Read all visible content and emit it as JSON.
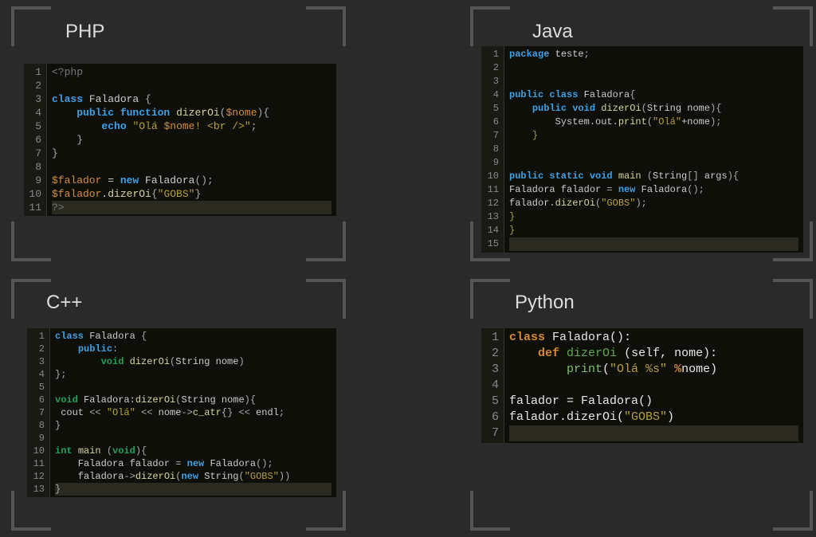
{
  "panels": {
    "php": {
      "title": "PHP",
      "lines": [
        {
          "n": "1",
          "segs": [
            {
              "c": "tag",
              "t": "<?php"
            }
          ]
        },
        {
          "n": "2",
          "segs": []
        },
        {
          "n": "3",
          "segs": [
            {
              "c": "kw",
              "t": "class"
            },
            {
              "c": "op",
              "t": " Faladora "
            },
            {
              "c": "pun",
              "t": "{"
            }
          ]
        },
        {
          "n": "4",
          "segs": [
            {
              "c": "op",
              "t": "    "
            },
            {
              "c": "kw",
              "t": "public function"
            },
            {
              "c": "op",
              "t": " "
            },
            {
              "c": "fn",
              "t": "dizerOi"
            },
            {
              "c": "pun",
              "t": "("
            },
            {
              "c": "var",
              "t": "$nome"
            },
            {
              "c": "pun",
              "t": "){"
            }
          ]
        },
        {
          "n": "5",
          "segs": [
            {
              "c": "op",
              "t": "        "
            },
            {
              "c": "kw",
              "t": "echo"
            },
            {
              "c": "op",
              "t": " "
            },
            {
              "c": "str",
              "t": "\"Olá "
            },
            {
              "c": "var",
              "t": "$nome"
            },
            {
              "c": "str",
              "t": "! <br />\""
            },
            {
              "c": "pun",
              "t": ";"
            }
          ]
        },
        {
          "n": "6",
          "segs": [
            {
              "c": "op",
              "t": "    "
            },
            {
              "c": "pun",
              "t": "}"
            }
          ]
        },
        {
          "n": "7",
          "segs": [
            {
              "c": "pun",
              "t": "}"
            }
          ]
        },
        {
          "n": "8",
          "segs": []
        },
        {
          "n": "9",
          "segs": [
            {
              "c": "var",
              "t": "$falador"
            },
            {
              "c": "op",
              "t": " = "
            },
            {
              "c": "kw",
              "t": "new"
            },
            {
              "c": "op",
              "t": " Faladora"
            },
            {
              "c": "pun",
              "t": "();"
            }
          ]
        },
        {
          "n": "10",
          "segs": [
            {
              "c": "var",
              "t": "$falador"
            },
            {
              "c": "op",
              "t": "."
            },
            {
              "c": "fn",
              "t": "dizerOi"
            },
            {
              "c": "pun",
              "t": "{"
            },
            {
              "c": "str",
              "t": "\"GOBS\""
            },
            {
              "c": "pun",
              "t": "}"
            }
          ]
        },
        {
          "n": "11",
          "segs": [
            {
              "c": "tag",
              "t": "?>"
            }
          ],
          "hl": true
        }
      ]
    },
    "java": {
      "title": "Java",
      "lines": [
        {
          "n": "1",
          "segs": [
            {
              "c": "kw",
              "t": "package"
            },
            {
              "c": "op",
              "t": " teste"
            },
            {
              "c": "pun",
              "t": ";"
            }
          ]
        },
        {
          "n": "2",
          "segs": []
        },
        {
          "n": "3",
          "segs": []
        },
        {
          "n": "4",
          "segs": [
            {
              "c": "kw",
              "t": "public class"
            },
            {
              "c": "op",
              "t": " Faladora"
            },
            {
              "c": "pun",
              "t": "{"
            }
          ]
        },
        {
          "n": "5",
          "segs": [
            {
              "c": "op",
              "t": "    "
            },
            {
              "c": "kw",
              "t": "public void"
            },
            {
              "c": "op",
              "t": " "
            },
            {
              "c": "fn",
              "t": "dizerOi"
            },
            {
              "c": "pun",
              "t": "("
            },
            {
              "c": "op",
              "t": "String nome"
            },
            {
              "c": "pun",
              "t": "){"
            }
          ]
        },
        {
          "n": "6",
          "segs": [
            {
              "c": "op",
              "t": "        System.out."
            },
            {
              "c": "fn",
              "t": "print"
            },
            {
              "c": "pun",
              "t": "("
            },
            {
              "c": "str",
              "t": "\"Olá\""
            },
            {
              "c": "op",
              "t": "+nome"
            },
            {
              "c": "pun",
              "t": ");"
            }
          ]
        },
        {
          "n": "7",
          "segs": [
            {
              "c": "op",
              "t": "    "
            },
            {
              "c": "olive",
              "t": "}"
            }
          ]
        },
        {
          "n": "8",
          "segs": []
        },
        {
          "n": "9",
          "segs": []
        },
        {
          "n": "10",
          "segs": [
            {
              "c": "kw",
              "t": "public static void"
            },
            {
              "c": "op",
              "t": " "
            },
            {
              "c": "fn",
              "t": "main"
            },
            {
              "c": "op",
              "t": " "
            },
            {
              "c": "pun",
              "t": "("
            },
            {
              "c": "op",
              "t": "String"
            },
            {
              "c": "pun",
              "t": "[] "
            },
            {
              "c": "op",
              "t": "args"
            },
            {
              "c": "pun",
              "t": "){"
            }
          ]
        },
        {
          "n": "11",
          "segs": [
            {
              "c": "op",
              "t": "Faladora falador "
            },
            {
              "c": "pun",
              "t": "= "
            },
            {
              "c": "kw",
              "t": "new"
            },
            {
              "c": "op",
              "t": " Faladora"
            },
            {
              "c": "pun",
              "t": "();"
            }
          ]
        },
        {
          "n": "12",
          "segs": [
            {
              "c": "op",
              "t": "falador."
            },
            {
              "c": "fn",
              "t": "dizerOi"
            },
            {
              "c": "pun",
              "t": "("
            },
            {
              "c": "str",
              "t": "\"GOBS\""
            },
            {
              "c": "pun",
              "t": ");"
            }
          ]
        },
        {
          "n": "13",
          "segs": [
            {
              "c": "olive",
              "t": "}"
            }
          ]
        },
        {
          "n": "14",
          "segs": [
            {
              "c": "olive",
              "t": "}"
            }
          ]
        },
        {
          "n": "15",
          "segs": [],
          "hl": true
        }
      ]
    },
    "cpp": {
      "title": "C++",
      "lines": [
        {
          "n": "1",
          "segs": [
            {
              "c": "kw",
              "t": "class"
            },
            {
              "c": "op",
              "t": " Faladora "
            },
            {
              "c": "pun",
              "t": "{"
            }
          ]
        },
        {
          "n": "2",
          "segs": [
            {
              "c": "op",
              "t": "    "
            },
            {
              "c": "kw",
              "t": "public"
            },
            {
              "c": "pun",
              "t": ":"
            }
          ]
        },
        {
          "n": "3",
          "segs": [
            {
              "c": "op",
              "t": "        "
            },
            {
              "c": "kw2",
              "t": "void"
            },
            {
              "c": "op",
              "t": " "
            },
            {
              "c": "fn",
              "t": "dizerOi"
            },
            {
              "c": "pun",
              "t": "("
            },
            {
              "c": "op",
              "t": "String nome"
            },
            {
              "c": "pun",
              "t": ")"
            }
          ]
        },
        {
          "n": "4",
          "segs": [
            {
              "c": "pun",
              "t": "};"
            }
          ]
        },
        {
          "n": "5",
          "segs": []
        },
        {
          "n": "6",
          "segs": [
            {
              "c": "kw2",
              "t": "void"
            },
            {
              "c": "op",
              "t": " Faladora:"
            },
            {
              "c": "fn",
              "t": "dizerOi"
            },
            {
              "c": "pun",
              "t": "("
            },
            {
              "c": "op",
              "t": "String nome"
            },
            {
              "c": "pun",
              "t": "){"
            }
          ]
        },
        {
          "n": "7",
          "segs": [
            {
              "c": "op",
              "t": " cout "
            },
            {
              "c": "pun",
              "t": "<< "
            },
            {
              "c": "str",
              "t": "\"Olá\""
            },
            {
              "c": "op",
              "t": " "
            },
            {
              "c": "pun",
              "t": "<< "
            },
            {
              "c": "op",
              "t": "nome"
            },
            {
              "c": "pun",
              "t": "->"
            },
            {
              "c": "fn",
              "t": "c_atr"
            },
            {
              "c": "pun",
              "t": "{} << "
            },
            {
              "c": "op",
              "t": "endl"
            },
            {
              "c": "pun",
              "t": ";"
            }
          ]
        },
        {
          "n": "8",
          "segs": [
            {
              "c": "pun",
              "t": "}"
            }
          ]
        },
        {
          "n": "9",
          "segs": []
        },
        {
          "n": "10",
          "segs": [
            {
              "c": "kw2",
              "t": "int"
            },
            {
              "c": "op",
              "t": " "
            },
            {
              "c": "fn",
              "t": "main"
            },
            {
              "c": "op",
              "t": " "
            },
            {
              "c": "pun",
              "t": "("
            },
            {
              "c": "kw2",
              "t": "void"
            },
            {
              "c": "pun",
              "t": "){"
            }
          ]
        },
        {
          "n": "11",
          "segs": [
            {
              "c": "op",
              "t": "    Faladora falador "
            },
            {
              "c": "pun",
              "t": "= "
            },
            {
              "c": "kw",
              "t": "new"
            },
            {
              "c": "op",
              "t": " Faladora"
            },
            {
              "c": "pun",
              "t": "();"
            }
          ]
        },
        {
          "n": "12",
          "segs": [
            {
              "c": "op",
              "t": "    faladora"
            },
            {
              "c": "pun",
              "t": "->"
            },
            {
              "c": "fn",
              "t": "dizerOi"
            },
            {
              "c": "pun",
              "t": "("
            },
            {
              "c": "kw",
              "t": "new"
            },
            {
              "c": "op",
              "t": " String"
            },
            {
              "c": "pun",
              "t": "("
            },
            {
              "c": "str",
              "t": "\"GOBS\""
            },
            {
              "c": "pun",
              "t": "))"
            }
          ]
        },
        {
          "n": "13",
          "segs": [
            {
              "c": "pun",
              "t": "}"
            }
          ],
          "hl": true
        }
      ]
    },
    "python": {
      "title": "Python",
      "lines": [
        {
          "n": "1",
          "segs": [
            {
              "c": "orange",
              "t": "class"
            },
            {
              "c": "white",
              "t": " "
            },
            {
              "c": "white",
              "t": "Faladora"
            },
            {
              "c": "white",
              "t": "():"
            }
          ]
        },
        {
          "n": "2",
          "segs": [
            {
              "c": "white",
              "t": "    "
            },
            {
              "c": "orange",
              "t": "def"
            },
            {
              "c": "white",
              "t": " "
            },
            {
              "c": "green",
              "t": "dizerOi"
            },
            {
              "c": "white",
              "t": " (self, nome):"
            }
          ]
        },
        {
          "n": "3",
          "segs": [
            {
              "c": "white",
              "t": "        "
            },
            {
              "c": "green2",
              "t": "print"
            },
            {
              "c": "white",
              "t": "("
            },
            {
              "c": "str",
              "t": "\"Olá %s\""
            },
            {
              "c": "white",
              "t": " "
            },
            {
              "c": "orange",
              "t": "%"
            },
            {
              "c": "white",
              "t": "nome)"
            }
          ]
        },
        {
          "n": "4",
          "segs": []
        },
        {
          "n": "5",
          "segs": [
            {
              "c": "white",
              "t": "falador = Faladora()"
            }
          ]
        },
        {
          "n": "6",
          "segs": [
            {
              "c": "white",
              "t": "falador.dizerOi("
            },
            {
              "c": "str",
              "t": "\"GOBS\""
            },
            {
              "c": "white",
              "t": ")"
            }
          ]
        },
        {
          "n": "7",
          "segs": [],
          "hl": true
        }
      ]
    }
  }
}
